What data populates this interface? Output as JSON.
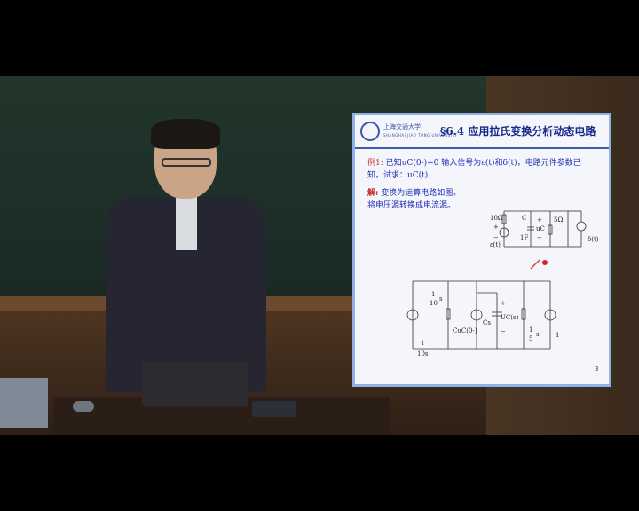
{
  "slide": {
    "title": "§6.4  应用拉氏变换分析动态电路",
    "logo_text": "上海交通大学",
    "logo_sub": "SHANGHAI JIAO TONG UNIVERSITY",
    "example_tag": "例1:",
    "example_line1": "已知uC(0-)=0 输入信号为ε(t)和δ(t)，电路元件参数已",
    "example_line2": "知，试求：uC(t)",
    "solution_tag": "解:",
    "solution_line1": "变换为运算电路如图。",
    "solution_line2": "将电压源转换成电流源。",
    "page_number": "3",
    "circuit_top": {
      "r1": "10Ω",
      "c": "C",
      "c_val": "1F",
      "uc": "uC",
      "r2": "5Ω",
      "src1": "ε(t)",
      "src2": "δ(t)",
      "plus1": "+",
      "minus1": "−",
      "plus2": "+",
      "minus2": "−"
    },
    "circuit_bottom": {
      "g1_num": "1",
      "g1_den": "10",
      "g1_s": "s",
      "src_left_num": "1",
      "src_left_den": "10s",
      "cu": "CuC(0-)",
      "cs": "Cs",
      "ucs": "UC(s)",
      "g2_num": "1",
      "g2_den": "5",
      "g2_s": "s",
      "src_right": "1",
      "plus": "+",
      "minus": "−"
    }
  },
  "colors": {
    "slide_bg": "#f4f6fb",
    "slide_border": "#8fb2e6",
    "title": "#1a2a8c",
    "text_blue": "#1d2db8",
    "tag_red": "#c0282a"
  }
}
